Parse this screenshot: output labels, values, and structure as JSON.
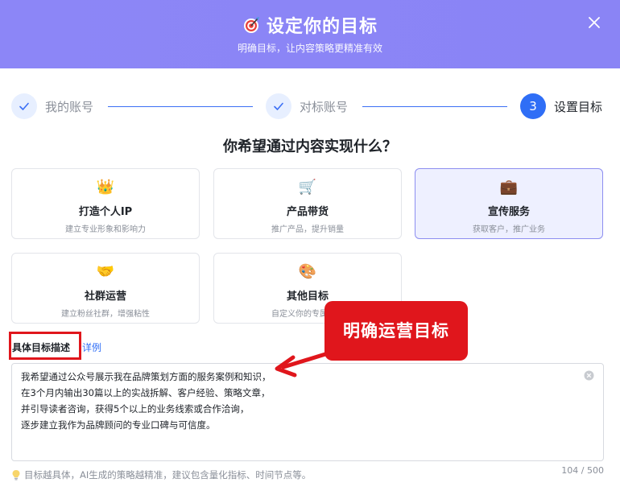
{
  "header": {
    "title": "设定你的目标",
    "subtitle": "明确目标，让内容策略更精准有效"
  },
  "steps": [
    {
      "label": "我的账号",
      "state": "done"
    },
    {
      "label": "对标账号",
      "state": "done"
    },
    {
      "label": "设置目标",
      "state": "active",
      "number": "3"
    }
  ],
  "question": "你希望通过内容实现什么？",
  "goals": [
    {
      "icon": "👑",
      "icon_name": "crown-icon",
      "title": "打造个人IP",
      "desc": "建立专业形象和影响力",
      "selected": false
    },
    {
      "icon": "🛒",
      "icon_name": "shopping-cart-icon",
      "title": "产品带货",
      "desc": "推广产品，提升销量",
      "selected": false
    },
    {
      "icon": "💼",
      "icon_name": "briefcase-icon",
      "title": "宣传服务",
      "desc": "获取客户，推广业务",
      "selected": true
    },
    {
      "icon": "🤝",
      "icon_name": "handshake-icon",
      "title": "社群运营",
      "desc": "建立粉丝社群，增强粘性",
      "selected": false
    },
    {
      "icon": "🎨",
      "icon_name": "palette-icon",
      "title": "其他目标",
      "desc": "自定义你的专属目标",
      "selected": false
    }
  ],
  "description": {
    "label": "具体目标描述",
    "example_link": "详例",
    "value": "我希望通过公众号展示我在品牌策划方面的服务案例和知识，\n在3个月内输出30篇以上的实战拆解、客户经验、策略文章，\n并引导读者咨询，获得5个以上的业务线索或合作洽询，\n逐步建立我作为品牌顾问的专业口碑与可信度。",
    "counter": "104 / 500",
    "tip": "目标越具体，AI生成的策略越精准，建议包含量化指标、时间节点等。"
  },
  "annotation": {
    "callout": "明确运营目标"
  },
  "colors": {
    "header": "#8c86f7",
    "primary": "#2f6ef6",
    "selected_border": "#8d8ef0",
    "annotation": "#e0161c"
  }
}
